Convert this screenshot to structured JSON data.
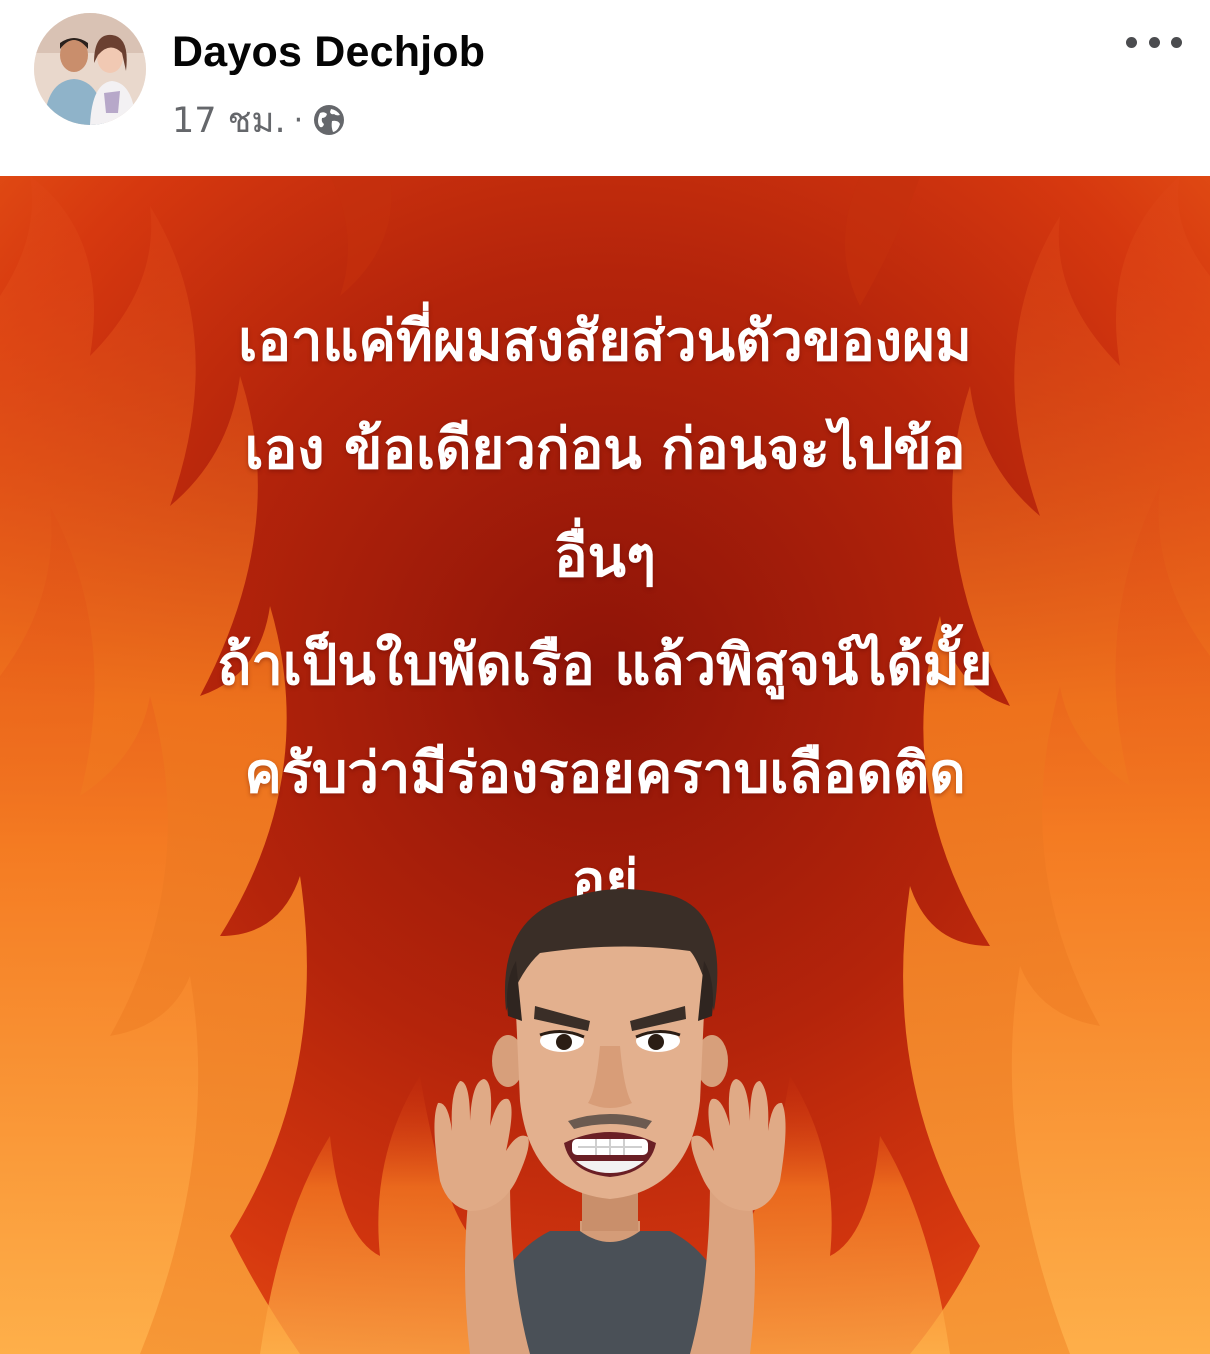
{
  "author": {
    "name": "Dayos Dechjob"
  },
  "meta": {
    "timestamp": "17 ชม.",
    "separator": "·",
    "audience_icon": "globe-icon"
  },
  "menu": {
    "icon": "more-horizontal-icon"
  },
  "image": {
    "background": "flames",
    "lines": [
      "เอาแค่ที่ผมสงสัยส่วนตัวของผม",
      "เอง ข้อเดียวก่อน  ก่อนจะไปข้อ",
      "อื่นๆ",
      "ถ้าเป็นใบพัดเรือ แล้วพิสูจน์ได้มั้ย",
      "ครับว่ามีร่องรอยคราบเลือดติด",
      "อยู่"
    ],
    "character": "angry-avatar"
  },
  "colors": {
    "fire_dark": "#8e1408",
    "fire_mid": "#d6380f",
    "fire_bright": "#f47a1e",
    "text": "#ffffff",
    "name": "#050505",
    "meta": "#65676b"
  }
}
